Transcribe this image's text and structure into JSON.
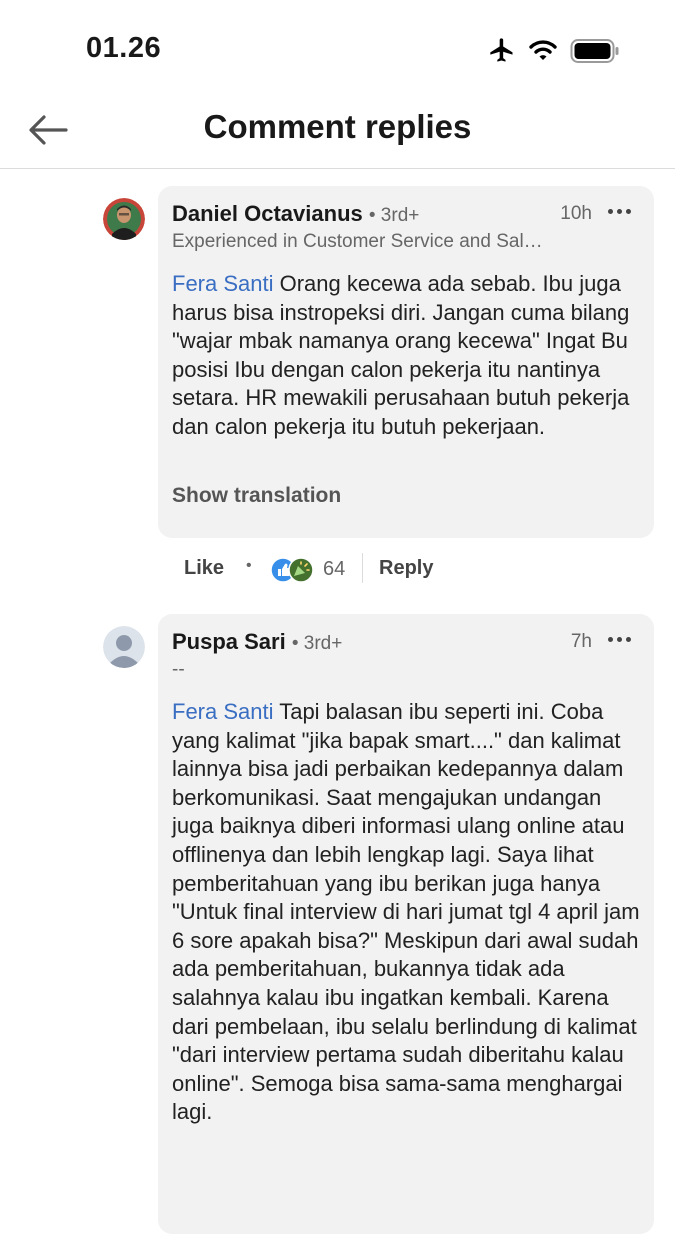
{
  "status_bar": {
    "time": "01.26"
  },
  "header": {
    "title": "Comment replies"
  },
  "comments": [
    {
      "author": "Daniel Octavianus",
      "degree": "• 3rd+",
      "time": "10h",
      "headline": "Experienced in Customer Service and Sal…",
      "mention": "Fera Santi",
      "text": " Orang kecewa ada sebab. Ibu juga harus bisa instropeksi diri. Jangan cuma bilang \"wajar mbak namanya orang kecewa\" Ingat Bu posisi Ibu dengan calon pekerja itu nantinya setara. HR mewakili perusahaan butuh pekerja dan calon pekerja itu butuh pekerjaan.",
      "show_translation": "Show translation",
      "like_label": "Like",
      "separator": "•",
      "reaction_count": "64",
      "reply_label": "Reply"
    },
    {
      "author": "Puspa Sari",
      "degree": "• 3rd+",
      "time": "7h",
      "headline": "--",
      "mention": "Fera Santi",
      "text": " Tapi balasan ibu seperti ini. Coba yang kalimat \"jika bapak smart....\" dan kalimat lainnya bisa jadi perbaikan kedepannya dalam berkomunikasi. Saat mengajukan undangan juga baiknya diberi informasi ulang online atau offlinenya dan lebih lengkap lagi. Saya lihat pemberitahuan yang ibu berikan juga hanya \"Untuk final interview di hari jumat tgl 4 april jam 6 sore apakah bisa?\" Meskipun dari awal sudah ada pemberitahuan, bukannya tidak ada salahnya kalau ibu ingatkan kembali. Karena dari pembelaan, ibu selalu berlindung di kalimat \"dari interview pertama sudah diberitahu kalau online\". Semoga bisa sama-sama menghargai lagi."
    }
  ],
  "colors": {
    "mention": "#3a6ec2",
    "bubble": "#f2f2f2",
    "muted": "#666666"
  },
  "icons": [
    "back-arrow-icon",
    "airplane-icon",
    "wifi-icon",
    "battery-icon",
    "more-icon",
    "thumbs-up-reaction-icon",
    "celebrate-reaction-icon"
  ]
}
